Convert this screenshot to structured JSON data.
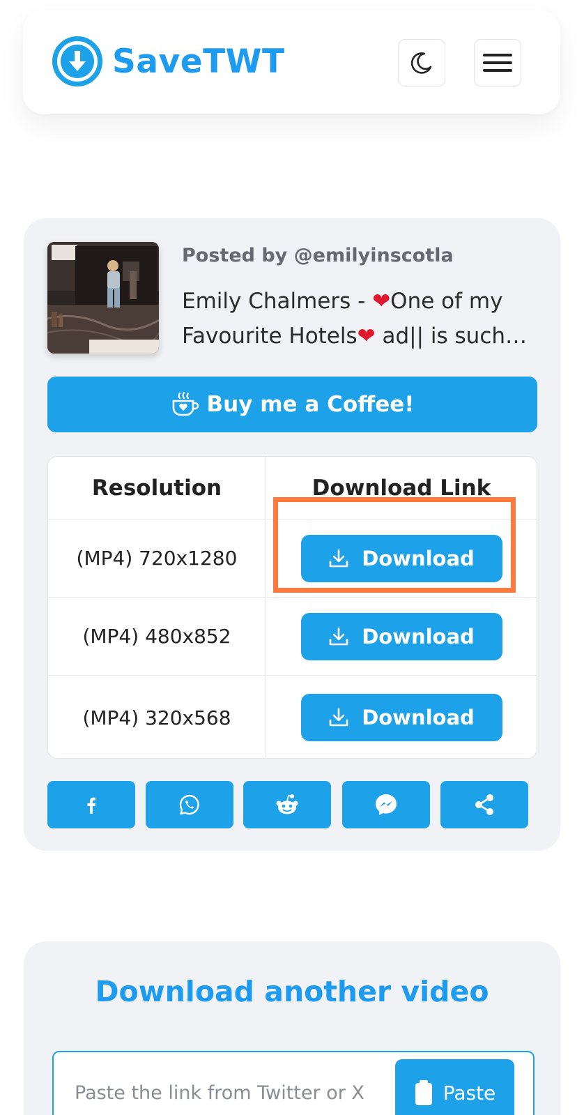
{
  "header": {
    "brand": "SaveTWT",
    "theme_toggle_icon": "moon-icon",
    "menu_icon": "hamburger-menu-icon"
  },
  "result": {
    "posted_by": "Posted by @emilyinscotla",
    "description_part1": "Emily Chalmers - ",
    "description_part2": "One of my Favourite Hotels",
    "description_part3": " ad|| is such…",
    "heart_glyph": "❤",
    "coffee_button": "Buy me a Coffee!",
    "table": {
      "headers": [
        "Resolution",
        "Download Link"
      ],
      "rows": [
        {
          "resolution": "(MP4) 720x1280",
          "action": "Download"
        },
        {
          "resolution": "(MP4) 480x852",
          "action": "Download"
        },
        {
          "resolution": "(MP4) 320x568",
          "action": "Download"
        }
      ]
    },
    "share_buttons": [
      "facebook-icon",
      "whatsapp-icon",
      "reddit-icon",
      "messenger-icon",
      "share-icon"
    ]
  },
  "another": {
    "title": "Download another video",
    "placeholder": "Paste the link from Twitter or X",
    "paste_button": "Paste"
  },
  "colors": {
    "accent": "#1da1e8",
    "highlight": "#ff7a3c",
    "card_bg": "#f1f2f5"
  }
}
